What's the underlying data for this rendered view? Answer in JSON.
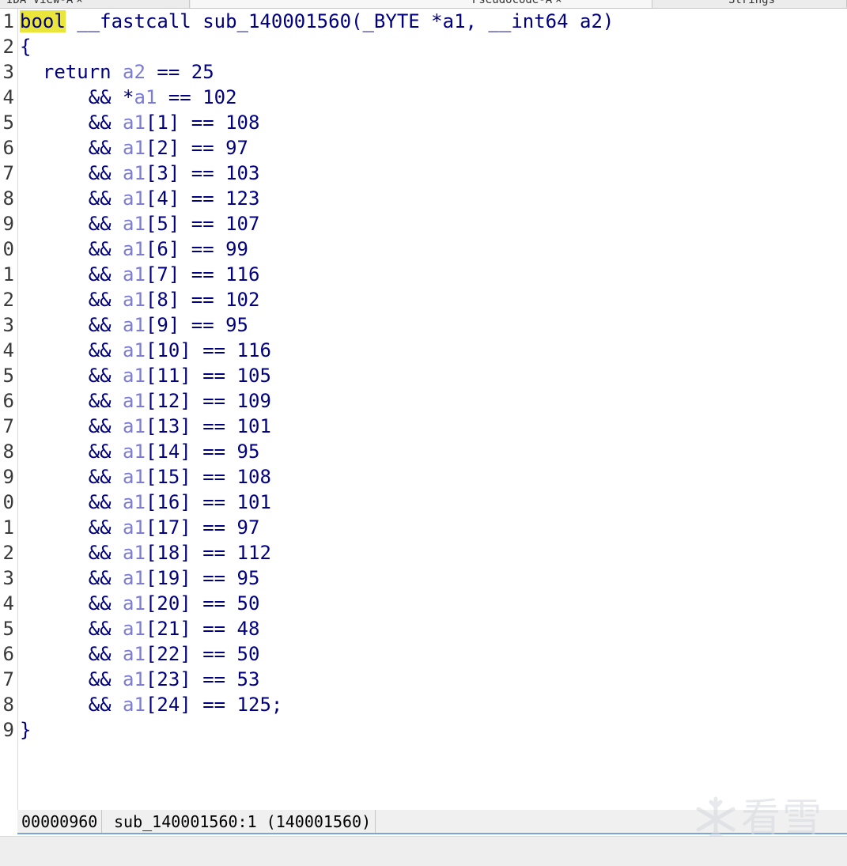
{
  "tabs": [
    {
      "label": "IDA View-A"
    },
    {
      "label": "Pseudocode-A"
    },
    {
      "label": "Strings"
    }
  ],
  "tab_close": "×",
  "editor": {
    "line_numbers": [
      "1",
      "2",
      "3",
      "4",
      "5",
      "6",
      "7",
      "8",
      "9",
      "0",
      "1",
      "2",
      "3",
      "4",
      "5",
      "6",
      "7",
      "8",
      "9",
      "0",
      "1",
      "2",
      "3",
      "4",
      "5",
      "6",
      "7",
      "8",
      "9"
    ],
    "signature": {
      "type_kw": "bool",
      "rest": " __fastcall sub_140001560(_BYTE *a1, __int64 a2)"
    },
    "open_brace": "{",
    "return_line": {
      "prefix": "  return ",
      "var": "a2",
      "suffix": " == 25"
    },
    "first_check": {
      "prefix": "      && *",
      "var": "a1",
      "suffix": " == 102"
    },
    "checks": [
      {
        "index": "[1]",
        "value": "108"
      },
      {
        "index": "[2]",
        "value": "97"
      },
      {
        "index": "[3]",
        "value": "103"
      },
      {
        "index": "[4]",
        "value": "123"
      },
      {
        "index": "[5]",
        "value": "107"
      },
      {
        "index": "[6]",
        "value": "99"
      },
      {
        "index": "[7]",
        "value": "116"
      },
      {
        "index": "[8]",
        "value": "102"
      },
      {
        "index": "[9]",
        "value": "95"
      },
      {
        "index": "[10]",
        "value": "116"
      },
      {
        "index": "[11]",
        "value": "105"
      },
      {
        "index": "[12]",
        "value": "109"
      },
      {
        "index": "[13]",
        "value": "101"
      },
      {
        "index": "[14]",
        "value": "95"
      },
      {
        "index": "[15]",
        "value": "108"
      },
      {
        "index": "[16]",
        "value": "101"
      },
      {
        "index": "[17]",
        "value": "97"
      },
      {
        "index": "[18]",
        "value": "112"
      },
      {
        "index": "[19]",
        "value": "95"
      },
      {
        "index": "[20]",
        "value": "50"
      },
      {
        "index": "[21]",
        "value": "48"
      },
      {
        "index": "[22]",
        "value": "50"
      },
      {
        "index": "[23]",
        "value": "53"
      },
      {
        "index": "[24]",
        "value": "125",
        "terminator": ";"
      }
    ],
    "check_prefix": "      && ",
    "check_var": "a1",
    "check_op": " == ",
    "close_brace": "}"
  },
  "status": {
    "address": "00000960",
    "location": "sub_140001560:1 (140001560)"
  },
  "watermark": {
    "text": "看雪"
  },
  "colors": {
    "keyword": "#000080",
    "variable": "#7b7bd8",
    "highlight": "#e9e53b"
  }
}
